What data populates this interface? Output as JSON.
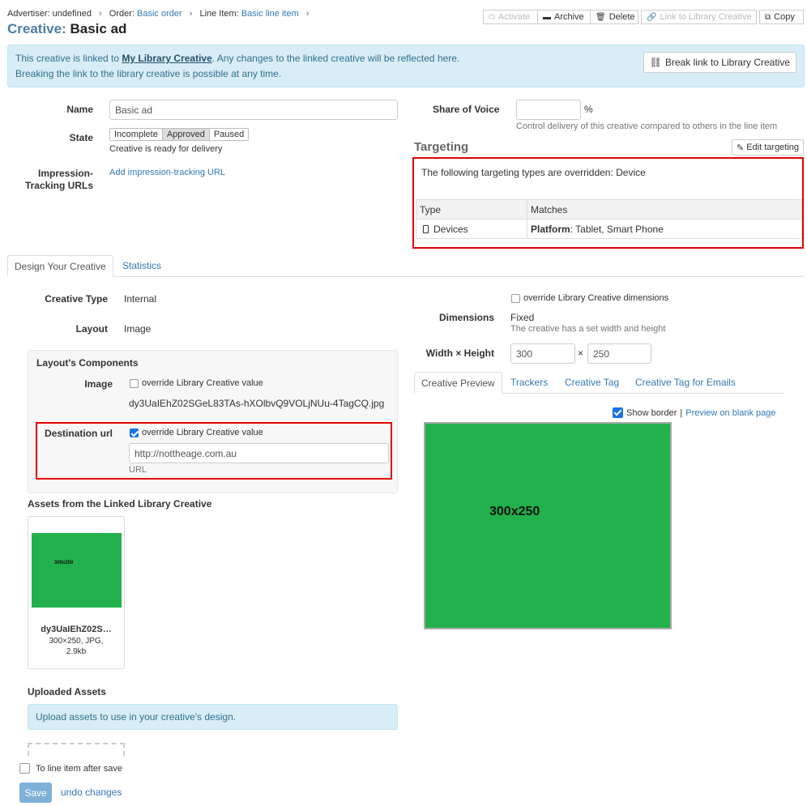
{
  "breadcrumb": {
    "advertiser_label": "Advertiser:",
    "advertiser_value": "undefined",
    "order_label": "Order:",
    "order_value": "Basic order",
    "line_item_label": "Line Item:",
    "line_item_value": "Basic line item",
    "separator": "›"
  },
  "title": {
    "label": "Creative:",
    "name": "Basic ad"
  },
  "toolbar": {
    "activate": "Activate",
    "archive": "Archive",
    "delete": "Delete",
    "link_library": "Link to Library Creative",
    "copy": "Copy"
  },
  "banner": {
    "line1_pre": "This creative is linked to ",
    "line1_link": "My Library Creative",
    "line1_post": ". Any changes to the linked creative will be reflected here.",
    "line2": "Breaking the link to the library creative is possible at any time.",
    "break_button": "Break link to Library Creative"
  },
  "form": {
    "name_label": "Name",
    "name_value": "Basic ad",
    "state_label": "State",
    "state_options": [
      "Incomplete",
      "Approved",
      "Paused"
    ],
    "state_selected": "Approved",
    "state_help": "Creative is ready for delivery",
    "impression_label_1": "Impression-",
    "impression_label_2": "Tracking URLs",
    "impression_link": "Add impression-tracking URL",
    "sov_label": "Share of Voice",
    "sov_value": "",
    "sov_unit": "%",
    "sov_help": "Control delivery of this creative compared to others in the line item"
  },
  "targeting": {
    "title": "Targeting",
    "edit_button": "Edit targeting",
    "note": "The following targeting types are overridden: Device",
    "columns": [
      "Type",
      "Matches"
    ],
    "rows": [
      {
        "type": "Devices",
        "match_key": "Platform",
        "match_value": ": Tablet, Smart Phone"
      }
    ]
  },
  "tabs": {
    "design": "Design Your Creative",
    "statistics": "Statistics"
  },
  "design": {
    "creative_type_label": "Creative Type",
    "creative_type_value": "Internal",
    "layout_label": "Layout",
    "layout_value": "Image",
    "components_title": "Layout's Components",
    "image_label": "Image",
    "override_text": "override Library Creative value",
    "image_value": "dy3UaIEhZ02SGeL83TAs-hXOlbvQ9VOLjNUu-4TagCQ.jpg",
    "dest_label": "Destination url",
    "dest_value": "http://nottheage.com.au",
    "dest_help": "URL",
    "override_dims": "override Library Creative dimensions",
    "dimensions_label": "Dimensions",
    "dimensions_value": "Fixed",
    "dimensions_help": "The creative has a set width and height",
    "wh_label": "Width × Height",
    "width": "300",
    "times": "×",
    "height": "250"
  },
  "assets": {
    "title": "Assets from the Linked Library Creative",
    "items": [
      {
        "name": "dy3UaIEhZ02S…",
        "meta1": "300×250, JPG,",
        "meta2": "2.9kb",
        "thumb_text": "300x250"
      }
    ],
    "uploaded_title": "Uploaded Assets",
    "upload_info": "Upload assets to use in your creative's design."
  },
  "preview_tabs": [
    "Creative Preview",
    "Trackers",
    "Creative Tag",
    "Creative Tag for Emails"
  ],
  "preview": {
    "show_border": "Show border",
    "divider": "|",
    "blank_page": "Preview on blank page",
    "creative_text": "300x250"
  },
  "footer": {
    "line_item_after_save": "To line item after save",
    "save": "Save",
    "undo": "undo changes"
  },
  "colors": {
    "accent": "#337ab7",
    "creative_bg": "#22b14c",
    "highlight_border": "#e30000"
  }
}
